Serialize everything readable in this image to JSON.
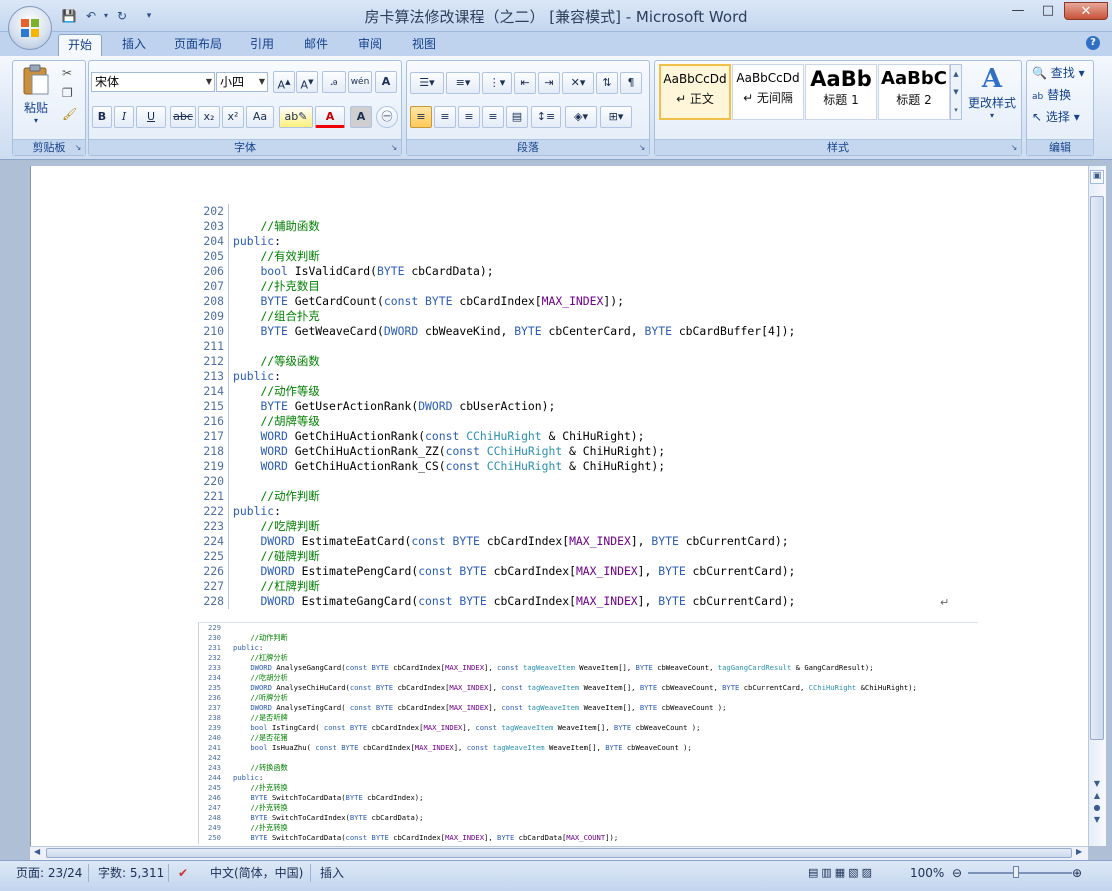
{
  "window": {
    "title": "房卡算法修改课程（之二） [兼容模式] - Microsoft Word"
  },
  "tabs": [
    "开始",
    "插入",
    "页面布局",
    "引用",
    "邮件",
    "审阅",
    "视图"
  ],
  "ribbon": {
    "clipboard": {
      "paste": "粘贴",
      "label": "剪贴板"
    },
    "font": {
      "name": "宋体",
      "size": "小四",
      "label": "字体",
      "bold": "B",
      "italic": "I",
      "underline": "U",
      "strike": "abc",
      "sub": "x₂",
      "sup": "x²",
      "case": "Aa",
      "char_a": "A"
    },
    "paragraph": {
      "label": "段落"
    },
    "styles": {
      "label": "样式",
      "items": [
        {
          "preview": "AaBbCcDd",
          "name": "↵ 正文"
        },
        {
          "preview": "AaBbCcDd",
          "name": "↵ 无间隔"
        },
        {
          "preview": "AaBb",
          "name": "标题 1"
        },
        {
          "preview": "AaBbC",
          "name": "标题 2"
        }
      ],
      "change": "更改样式"
    },
    "editing": {
      "find": "查找",
      "replace": "替换",
      "select": "选择",
      "label": "编辑"
    }
  },
  "code_main": [
    {
      "n": "202",
      "t": ""
    },
    {
      "n": "203",
      "t": "    //辅助函数"
    },
    {
      "n": "204",
      "t": "public:"
    },
    {
      "n": "205",
      "t": "    //有效判断"
    },
    {
      "n": "206",
      "t": "    bool IsValidCard(BYTE cbCardData);"
    },
    {
      "n": "207",
      "t": "    //扑克数目"
    },
    {
      "n": "208",
      "t": "    BYTE GetCardCount(const BYTE cbCardIndex[MAX_INDEX]);"
    },
    {
      "n": "209",
      "t": "    //组合扑克"
    },
    {
      "n": "210",
      "t": "    BYTE GetWeaveCard(DWORD cbWeaveKind, BYTE cbCenterCard, BYTE cbCardBuffer[4]);"
    },
    {
      "n": "211",
      "t": ""
    },
    {
      "n": "212",
      "t": "    //等级函数"
    },
    {
      "n": "213",
      "t": "public:"
    },
    {
      "n": "214",
      "t": "    //动作等级"
    },
    {
      "n": "215",
      "t": "    BYTE GetUserActionRank(DWORD cbUserAction);"
    },
    {
      "n": "216",
      "t": "    //胡牌等级"
    },
    {
      "n": "217",
      "t": "    WORD GetChiHuActionRank(const CChiHuRight & ChiHuRight);"
    },
    {
      "n": "218",
      "t": "    WORD GetChiHuActionRank_ZZ(const CChiHuRight & ChiHuRight);"
    },
    {
      "n": "219",
      "t": "    WORD GetChiHuActionRank_CS(const CChiHuRight & ChiHuRight);"
    },
    {
      "n": "220",
      "t": ""
    },
    {
      "n": "221",
      "t": "    //动作判断"
    },
    {
      "n": "222",
      "t": "public:"
    },
    {
      "n": "223",
      "t": "    //吃牌判断"
    },
    {
      "n": "224",
      "t": "    DWORD EstimateEatCard(const BYTE cbCardIndex[MAX_INDEX], BYTE cbCurrentCard);"
    },
    {
      "n": "225",
      "t": "    //碰牌判断"
    },
    {
      "n": "226",
      "t": "    DWORD EstimatePengCard(const BYTE cbCardIndex[MAX_INDEX], BYTE cbCurrentCard);"
    },
    {
      "n": "227",
      "t": "    //杠牌判断"
    },
    {
      "n": "228",
      "t": "    DWORD EstimateGangCard(const BYTE cbCardIndex[MAX_INDEX], BYTE cbCurrentCard);"
    }
  ],
  "code_small": [
    {
      "n": "229",
      "t": ""
    },
    {
      "n": "230",
      "t": "    //动作判断"
    },
    {
      "n": "231",
      "t": "public:"
    },
    {
      "n": "232",
      "t": "    //杠牌分析"
    },
    {
      "n": "233",
      "t": "    DWORD AnalyseGangCard(const BYTE cbCardIndex[MAX_INDEX], const tagWeaveItem WeaveItem[], BYTE cbWeaveCount, tagGangCardResult & GangCardResult);"
    },
    {
      "n": "234",
      "t": "    //吃胡分析"
    },
    {
      "n": "235",
      "t": "    DWORD AnalyseChiHuCard(const BYTE cbCardIndex[MAX_INDEX], const tagWeaveItem WeaveItem[], BYTE cbWeaveCount, BYTE cbCurrentCard, CChiHuRight &ChiHuRight);"
    },
    {
      "n": "236",
      "t": "    //听牌分析"
    },
    {
      "n": "237",
      "t": "    DWORD AnalyseTingCard( const BYTE cbCardIndex[MAX_INDEX], const tagWeaveItem WeaveItem[], BYTE cbWeaveCount );"
    },
    {
      "n": "238",
      "t": "    //是否听牌"
    },
    {
      "n": "239",
      "t": "    bool IsTingCard( const BYTE cbCardIndex[MAX_INDEX], const tagWeaveItem WeaveItem[], BYTE cbWeaveCount );"
    },
    {
      "n": "240",
      "t": "    //是否花猪"
    },
    {
      "n": "241",
      "t": "    bool IsHuaZhu( const BYTE cbCardIndex[MAX_INDEX], const tagWeaveItem WeaveItem[], BYTE cbWeaveCount );"
    },
    {
      "n": "242",
      "t": ""
    },
    {
      "n": "243",
      "t": "    //转换函数"
    },
    {
      "n": "244",
      "t": "public:"
    },
    {
      "n": "245",
      "t": "    //扑克转换"
    },
    {
      "n": "246",
      "t": "    BYTE SwitchToCardData(BYTE cbCardIndex);"
    },
    {
      "n": "247",
      "t": "    //扑克转换"
    },
    {
      "n": "248",
      "t": "    BYTE SwitchToCardIndex(BYTE cbCardData);"
    },
    {
      "n": "249",
      "t": "    //扑克转换"
    },
    {
      "n": "250",
      "t": "    BYTE SwitchToCardData(const BYTE cbCardIndex[MAX_INDEX], BYTE cbCardData[MAX_COUNT]);"
    }
  ],
  "status": {
    "page": "页面: 23/24",
    "words": "字数: 5,311",
    "lang": "中文(简体，中国)",
    "mode": "插入",
    "zoom": "100%"
  },
  "colors": {
    "accent": "#15428b",
    "comment": "#008000",
    "keyword": "#2b5db5"
  }
}
